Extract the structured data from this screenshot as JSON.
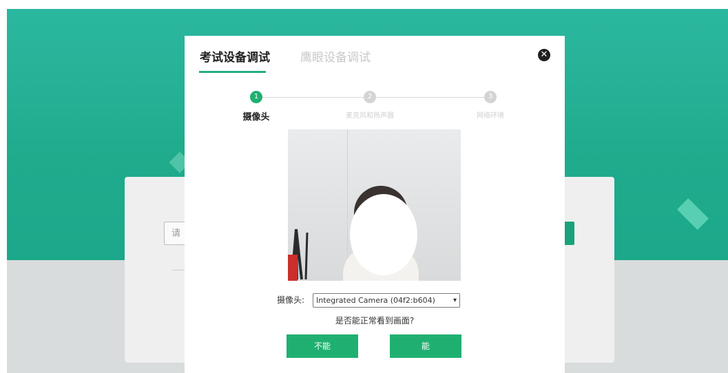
{
  "background": {
    "colors": {
      "teal": "#1fab8c",
      "gray": "#d9dcdc"
    },
    "login_input_placeholder": "请"
  },
  "modal": {
    "tabs": [
      {
        "label": "考试设备调试",
        "active": true
      },
      {
        "label": "鹰眼设备调试",
        "active": false
      }
    ],
    "close_icon": "close-circle-icon",
    "close_glyph": "✕",
    "steps": [
      {
        "number": "1",
        "label": "摄像头",
        "active": true
      },
      {
        "number": "2",
        "label": "麦克风和扬声器",
        "active": false
      },
      {
        "number": "3",
        "label": "网络环境",
        "active": false
      }
    ],
    "camera_label": "摄像头:",
    "camera_selected": "Integrated Camera (04f2:b604)",
    "question": "是否能正常看到画面?",
    "buttons": {
      "no": "不能",
      "yes": "能"
    },
    "accent_color": "#1fb071"
  }
}
